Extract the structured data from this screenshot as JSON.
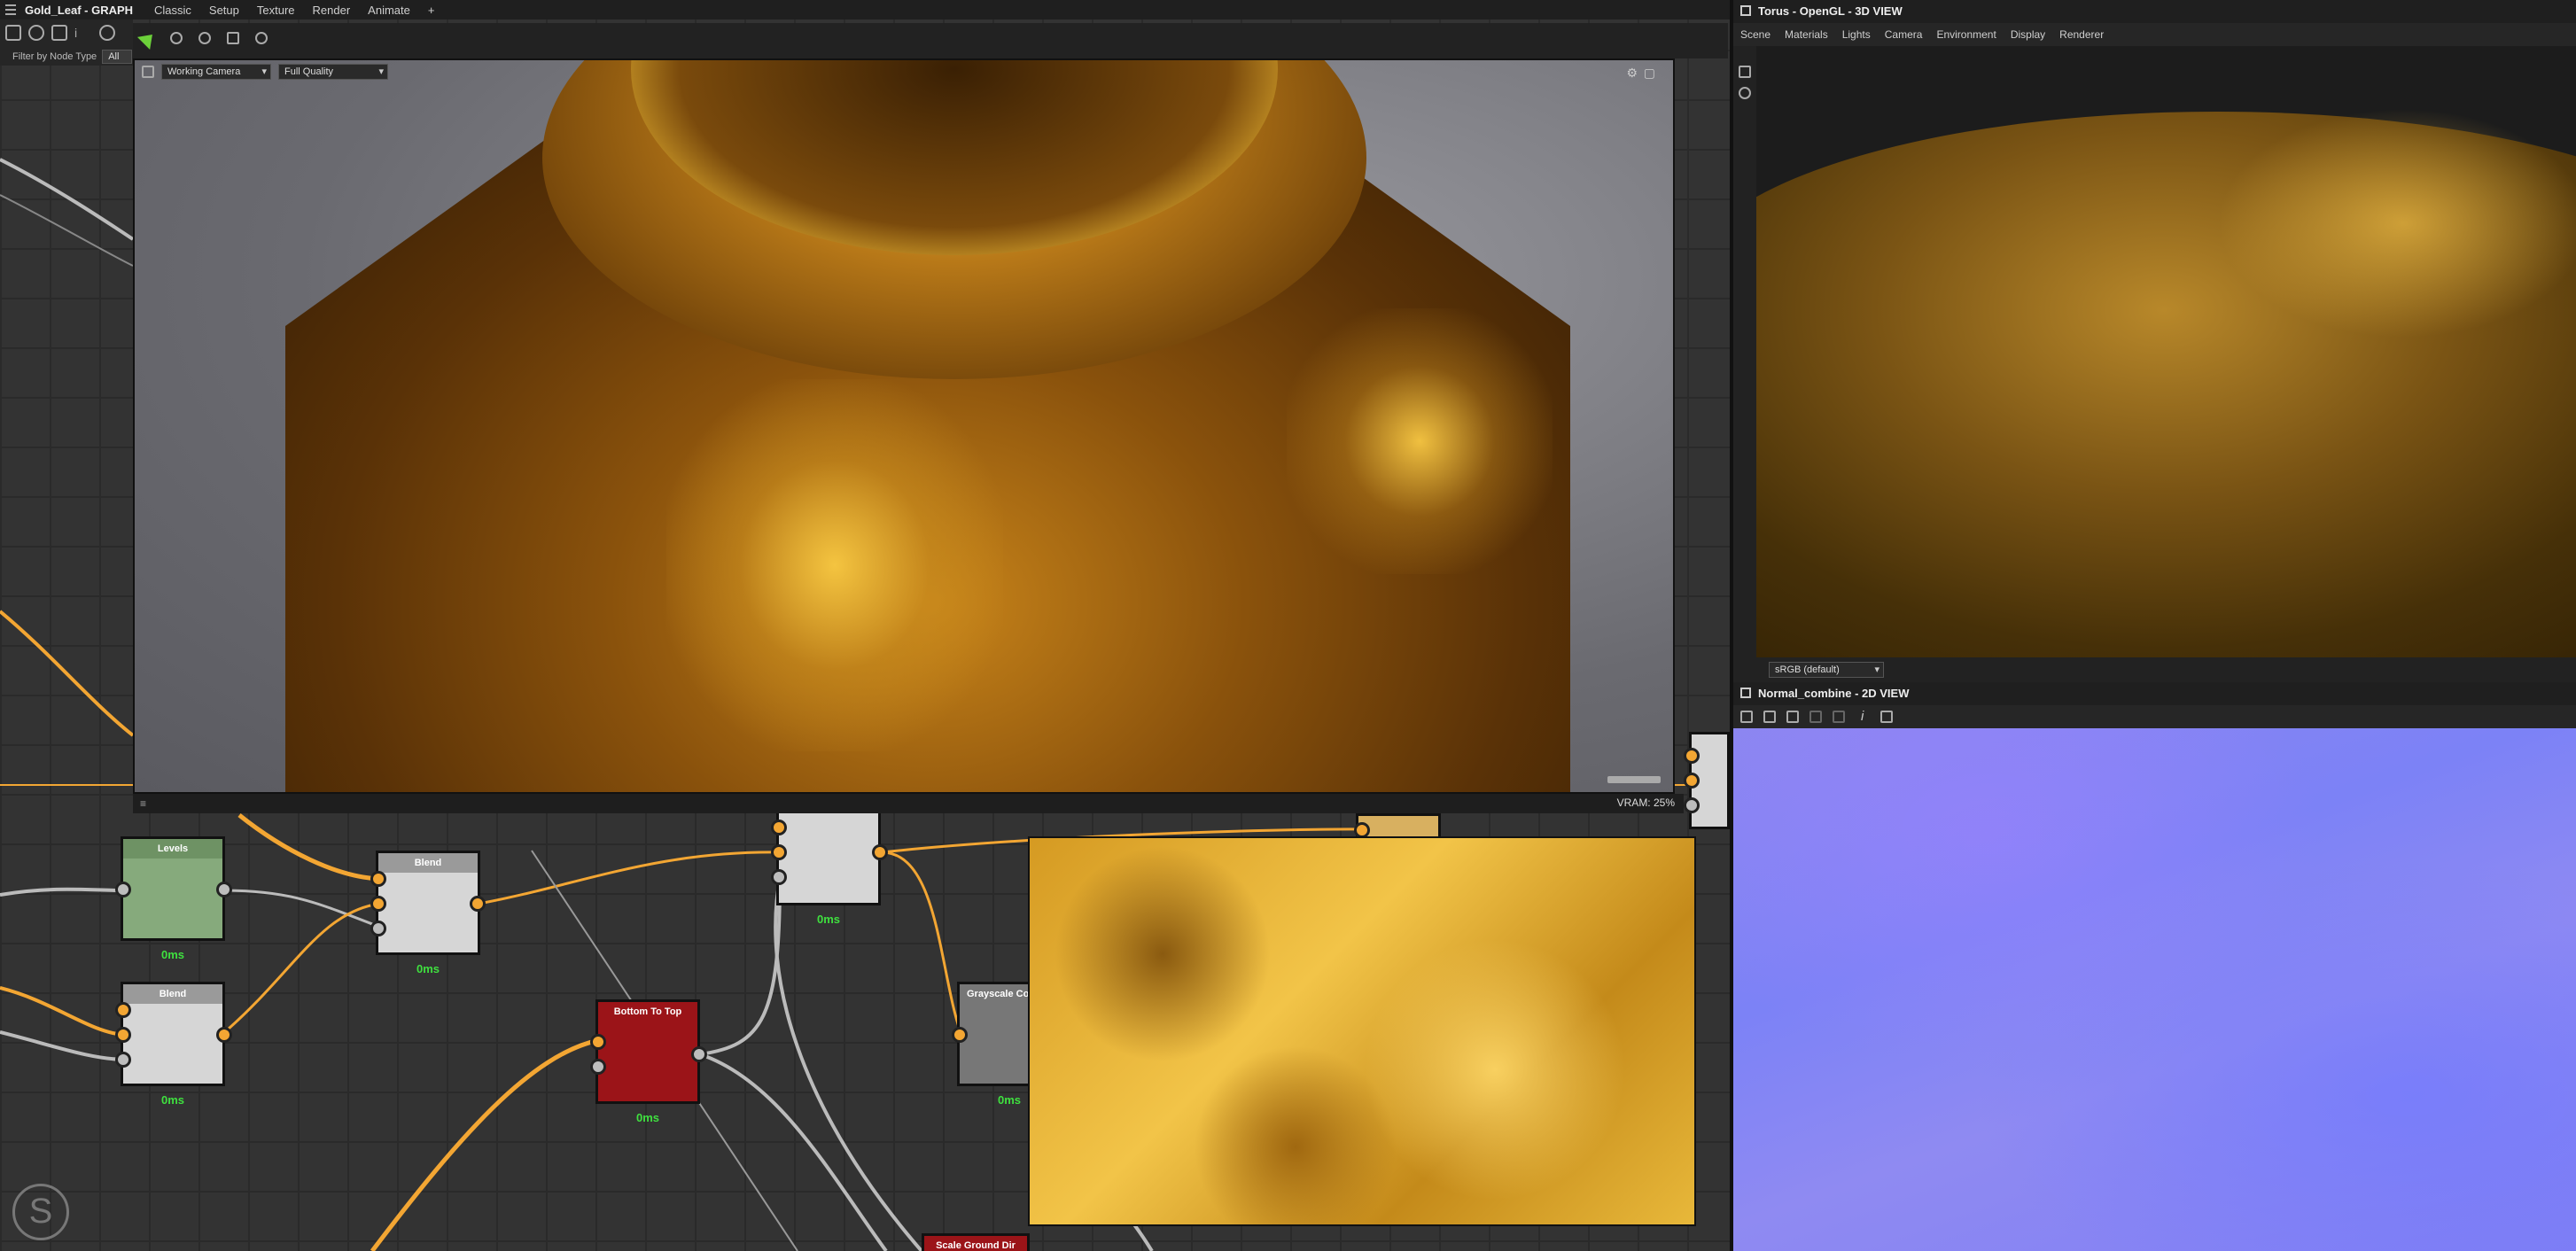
{
  "graph": {
    "title": "Gold_Leaf - GRAPH",
    "menu": [
      "Classic",
      "Setup",
      "Texture",
      "Render",
      "Animate",
      "+"
    ],
    "filter_label": "Filter by Node Type",
    "filter_value": "All",
    "nodes": {
      "levels": {
        "label": "Levels",
        "time": "0ms"
      },
      "blend1": {
        "label": "Blend",
        "time": "0ms"
      },
      "blend2": {
        "label": "Blend",
        "time": "0ms"
      },
      "bottom_to_top": {
        "label": "Bottom To Top",
        "time": "0ms"
      },
      "mid_node": {
        "label": "",
        "time": "0ms"
      },
      "grayscale": {
        "label": "Grayscale Conv",
        "time": "0ms"
      },
      "bottom_node": {
        "label": "Scale Ground Dir"
      }
    }
  },
  "viewport": {
    "camera": "Working Camera",
    "quality": "Full Quality",
    "vram": "VRAM: 25%"
  },
  "view3d": {
    "title": "Torus - OpenGL - 3D VIEW",
    "menu": [
      "Scene",
      "Materials",
      "Lights",
      "Camera",
      "Environment",
      "Display",
      "Renderer"
    ],
    "colorspace": "sRGB (default)"
  },
  "view2d": {
    "title": "Normal_combine - 2D VIEW"
  },
  "colors": {
    "accent_wire": "#f3a633",
    "node_time": "#3fe03f",
    "red_node": "#9b1418",
    "green_node": "#86aa7c"
  }
}
